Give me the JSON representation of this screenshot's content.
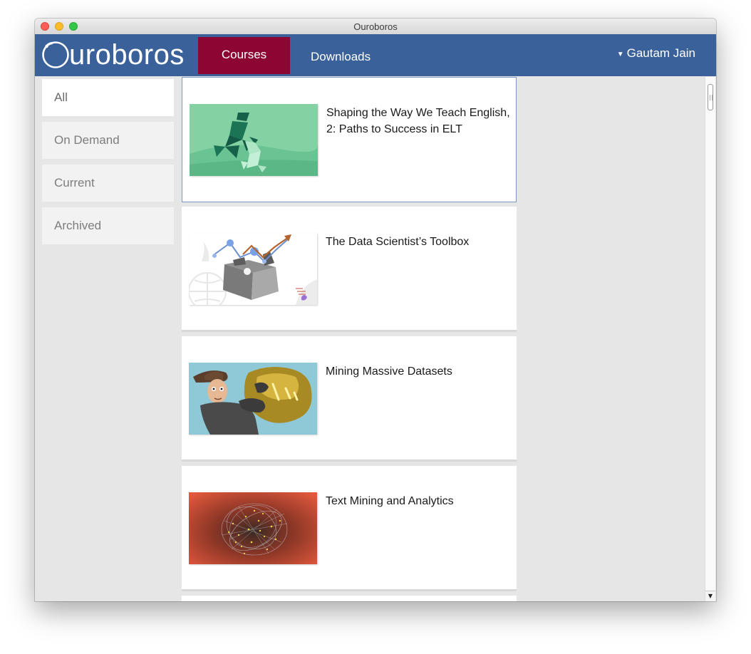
{
  "window": {
    "title": "Ouroboros"
  },
  "header": {
    "logo_text": "uroboros",
    "tabs": [
      {
        "label": "Courses",
        "active": true
      },
      {
        "label": "Downloads",
        "active": false
      }
    ],
    "user_name": "Gautam Jain"
  },
  "sidebar": {
    "items": [
      {
        "label": "All",
        "active": true
      },
      {
        "label": "On Demand",
        "active": false
      },
      {
        "label": "Current",
        "active": false
      },
      {
        "label": "Archived",
        "active": false
      }
    ]
  },
  "courses": [
    {
      "title": "Shaping the Way We Teach English, 2: Paths to Success in ELT",
      "image": "tangram-figures-image",
      "selected": true
    },
    {
      "title": "The Data Scientist’s Toolbox",
      "image": "toolbox-image",
      "selected": false
    },
    {
      "title": "Mining Massive Datasets",
      "image": "miner-gold-nugget-image",
      "selected": false
    },
    {
      "title": "Text Mining and Analytics",
      "image": "network-cluster-image",
      "selected": false
    }
  ],
  "colors": {
    "navbar": "#3a6199",
    "active_tab": "#8d0533",
    "content_bg": "#e6e6e6",
    "selected_border": "#7e97c2"
  }
}
